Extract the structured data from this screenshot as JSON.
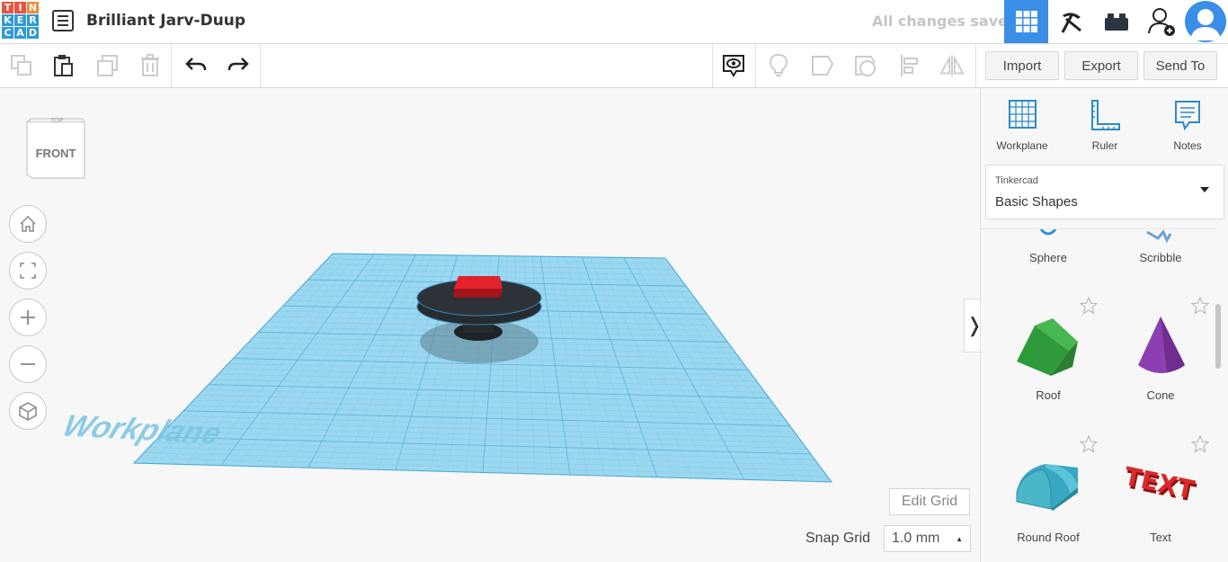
{
  "logo": {
    "letters": [
      "T",
      "I",
      "N",
      "K",
      "E",
      "R",
      "C",
      "A",
      "D"
    ],
    "colors": [
      "#e8523f",
      "#e8523f",
      "#f28a2e",
      "#2e9ad6",
      "#2e9ad6",
      "#2e9ad6",
      "#2e9ad6",
      "#2e9ad6",
      "#2e9ad6"
    ]
  },
  "header": {
    "title": "Brilliant Jarv-Duup",
    "status": "All changes saved",
    "views": [
      "grid-view-icon",
      "pickaxe-icon",
      "brick-icon",
      "add-user-icon"
    ]
  },
  "toolbar": {
    "import_label": "Import",
    "export_label": "Export",
    "send_to_label": "Send To",
    "icons": [
      "copy-icon",
      "paste-icon",
      "duplicate-icon",
      "delete-icon",
      "undo-icon",
      "redo-icon",
      "show-icon",
      "light-icon",
      "shape-icon",
      "hole-icon",
      "align-icon",
      "mirror-icon"
    ]
  },
  "viewcube": {
    "top_label": "TOP",
    "front_label": "FRONT"
  },
  "nav": [
    "home-icon",
    "fit-icon",
    "zoom-in-icon",
    "zoom-out-icon",
    "perspective-icon"
  ],
  "workplane": {
    "watermark": "Workplane",
    "color": "#8fd3ee"
  },
  "grid": {
    "edit_label": "Edit Grid",
    "snap_label": "Snap Grid",
    "snap_value": "1.0 mm"
  },
  "panel": {
    "tools": [
      {
        "label": "Workplane",
        "icon": "workplane-icon"
      },
      {
        "label": "Ruler",
        "icon": "ruler-icon"
      },
      {
        "label": "Notes",
        "icon": "notes-icon"
      }
    ],
    "library_source": "Tinkercad",
    "library_name": "Basic Shapes",
    "shapes": [
      {
        "name": "Sphere",
        "color": "#2f8fd1"
      },
      {
        "name": "Scribble",
        "color": "#6aa3d8"
      },
      {
        "name": "Roof",
        "color": "#3aa845"
      },
      {
        "name": "Cone",
        "color": "#8b3fb0"
      },
      {
        "name": "Round Roof",
        "color": "#4ab6c9"
      },
      {
        "name": "Text",
        "color": "#d92a2a"
      }
    ],
    "text_shape_glyph": "TEXT"
  }
}
